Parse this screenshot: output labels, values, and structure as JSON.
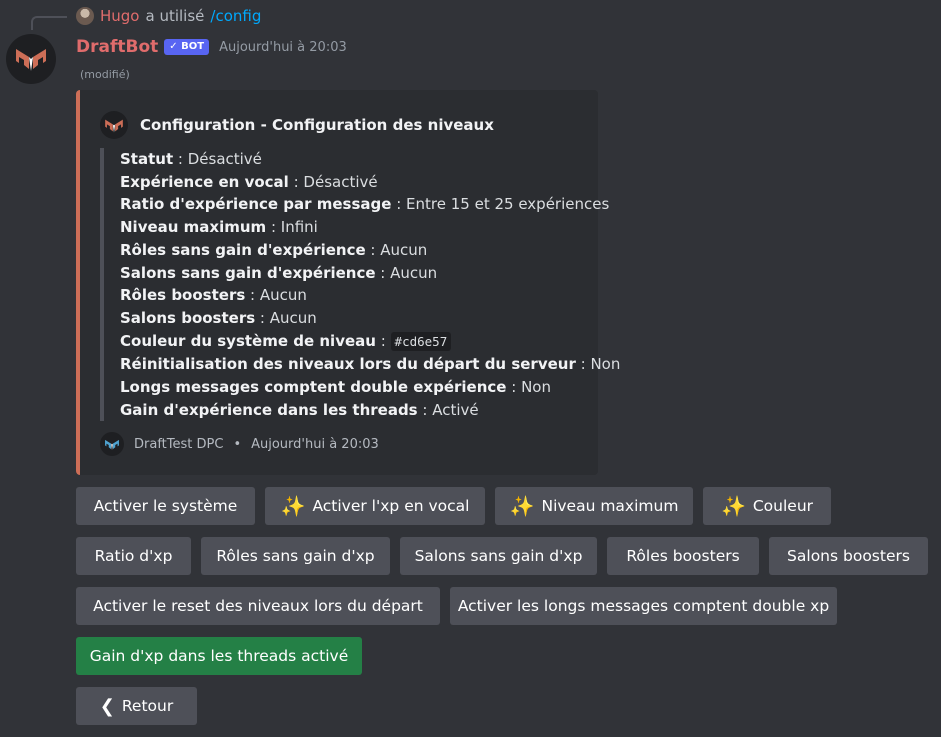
{
  "reply": {
    "user": "Hugo",
    "text": "a utilisé",
    "command": "/config"
  },
  "message": {
    "author": "DraftBot",
    "bot_tag": "✓ BOT",
    "timestamp": "Aujourd'hui à 20:03",
    "edited": "(modifié)"
  },
  "embed": {
    "color": "#cd6e57",
    "title": "Configuration - Configuration des niveaux",
    "fields": [
      {
        "name": "Statut",
        "value": "Désactivé"
      },
      {
        "name": "Expérience en vocal",
        "value": "Désactivé"
      },
      {
        "name": "Ratio d'expérience par message",
        "value": "Entre 15 et 25 expériences"
      },
      {
        "name": "Niveau maximum",
        "value": "Infini"
      },
      {
        "name": "Rôles sans gain d'expérience",
        "value": "Aucun"
      },
      {
        "name": "Salons sans gain d'expérience",
        "value": "Aucun"
      },
      {
        "name": "Rôles boosters",
        "value": "Aucun"
      },
      {
        "name": "Salons boosters",
        "value": "Aucun"
      },
      {
        "name": "Couleur du système de niveau",
        "value": "#cd6e57"
      },
      {
        "name": "Réinitialisation des niveaux lors du départ du serveur",
        "value": "Non"
      },
      {
        "name": "Longs messages comptent double expérience",
        "value": "Non"
      },
      {
        "name": "Gain d'expérience dans les threads",
        "value": "Activé"
      }
    ],
    "footer": {
      "server": "DraftTest DPC",
      "separator": "•",
      "time": "Aujourd'hui à 20:03"
    }
  },
  "buttons": {
    "activate_system": "Activer le système",
    "activate_voice_xp": "Activer l'xp en vocal",
    "max_level": "Niveau maximum",
    "color": "Couleur",
    "xp_ratio": "Ratio d'xp",
    "roles_no_xp": "Rôles sans gain d'xp",
    "channels_no_xp": "Salons sans gain d'xp",
    "roles_boosters": "Rôles boosters",
    "channels_boosters": "Salons boosters",
    "reset_on_leave": "Activer le reset des niveaux lors du départ",
    "long_messages": "Activer les longs messages comptent double xp",
    "threads_xp": "Gain d'xp dans les threads activé",
    "back": "Retour"
  },
  "icons": {
    "sparkle": "✨",
    "back": "❮"
  },
  "colors": {
    "background": "#313338",
    "embed_bg": "#2b2d31",
    "secondary_button": "#4e5058",
    "success_button": "#248046",
    "bot_tag": "#5865f2",
    "author_name": "#e06c6c"
  }
}
